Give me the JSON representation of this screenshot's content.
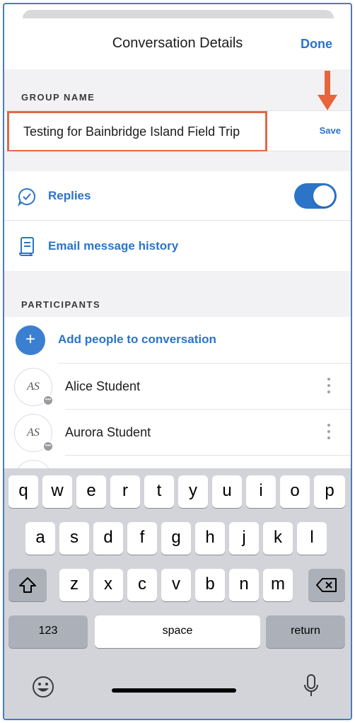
{
  "nav": {
    "title": "Conversation Details",
    "done_label": "Done"
  },
  "group_name": {
    "section_label": "GROUP NAME",
    "value": "Testing for Bainbridge Island Field Trip",
    "save_label": "Save"
  },
  "settings": {
    "replies_label": "Replies",
    "replies_enabled": true,
    "email_history_label": "Email message history"
  },
  "participants": {
    "section_label": "PARTICIPANTS",
    "add_label": "Add people to conversation",
    "people": [
      {
        "initials": "AS",
        "name": "Alice Student"
      },
      {
        "initials": "AS",
        "name": "Aurora Student"
      }
    ]
  },
  "keyboard": {
    "row1": [
      "q",
      "w",
      "e",
      "r",
      "t",
      "y",
      "u",
      "i",
      "o",
      "p"
    ],
    "row2": [
      "a",
      "s",
      "d",
      "f",
      "g",
      "h",
      "j",
      "k",
      "l"
    ],
    "row3": [
      "z",
      "x",
      "c",
      "v",
      "b",
      "n",
      "m"
    ],
    "numbers_label": "123",
    "space_label": "space",
    "return_label": "return"
  },
  "colors": {
    "accent": "#2b74c7",
    "highlight": "#e06a45"
  }
}
